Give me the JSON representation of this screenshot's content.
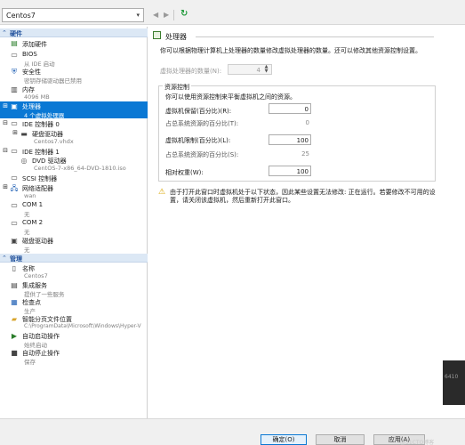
{
  "toolbar": {
    "vm_name": "Centos7",
    "back_icon": "back-arrow-icon",
    "forward_icon": "forward-arrow-icon",
    "refresh_icon": "refresh-icon"
  },
  "sidebar": {
    "hardware_header": "硬件",
    "management_header": "管理",
    "hardware_items": [
      {
        "label": "添加硬件",
        "sub": "",
        "icon": "add-hardware-icon"
      },
      {
        "label": "BIOS",
        "sub": "从 IDE 启动",
        "icon": "bios-icon"
      },
      {
        "label": "安全性",
        "sub": "密钥存储驱动器已禁用",
        "icon": "shield-icon"
      },
      {
        "label": "内存",
        "sub": "4096 MB",
        "icon": "memory-icon"
      },
      {
        "label": "处理器",
        "sub": "4 个虚拟处理器",
        "icon": "processor-icon"
      },
      {
        "label": "IDE 控制器 0",
        "sub": "",
        "icon": "ide-controller-icon"
      },
      {
        "label": "硬盘驱动器",
        "sub": "Centos7.vhdx",
        "icon": "hard-drive-icon"
      },
      {
        "label": "IDE 控制器 1",
        "sub": "",
        "icon": "ide-controller-icon"
      },
      {
        "label": "DVD 驱动器",
        "sub": "CentOS-7-x86_64-DVD-1810.iso",
        "icon": "dvd-icon"
      },
      {
        "label": "SCSI 控制器",
        "sub": "",
        "icon": "scsi-controller-icon"
      },
      {
        "label": "网络适配器",
        "sub": "wan",
        "icon": "network-adapter-icon"
      },
      {
        "label": "COM 1",
        "sub": "无",
        "icon": "com-port-icon"
      },
      {
        "label": "COM 2",
        "sub": "无",
        "icon": "com-port-icon"
      },
      {
        "label": "磁盘驱动器",
        "sub": "无",
        "icon": "floppy-icon"
      }
    ],
    "management_items": [
      {
        "label": "名称",
        "sub": "Centos7",
        "icon": "name-icon"
      },
      {
        "label": "集成服务",
        "sub": "提供了一些服务",
        "icon": "integration-services-icon"
      },
      {
        "label": "检查点",
        "sub": "生产",
        "icon": "checkpoint-icon"
      },
      {
        "label": "智能分页文件位置",
        "sub": "C:\\ProgramData\\Microsoft\\Windows\\Hyper-V",
        "icon": "folder-icon"
      },
      {
        "label": "自动启动操作",
        "sub": "始终启动",
        "icon": "auto-start-icon"
      },
      {
        "label": "自动停止操作",
        "sub": "保存",
        "icon": "auto-stop-icon"
      }
    ]
  },
  "processor": {
    "header": "处理器",
    "description": "你可以根据物理计算机上处理器的数量修改虚拟处理器的数量。还可以修改其他资源控制设置。",
    "vproc_label": "虚拟处理器的数量(N):",
    "vproc_value": "4",
    "resource_group_title": "资源控制",
    "resource_group_desc": "你可以使用资源控制来平衡虚拟机之间的资源。",
    "reserve_label": "虚拟机保留(百分比)(R):",
    "reserve_value": "0",
    "reserve_total_label": "占总系统资源的百分比(T):",
    "reserve_total_value": "0",
    "limit_label": "虚拟机限制(百分比)(L):",
    "limit_value": "100",
    "limit_total_label": "占总系统资源的百分比(S):",
    "limit_total_value": "25",
    "weight_label": "相对权重(W):",
    "weight_value": "100",
    "warning_text": "由于打开此窗口时虚拟机处于以下状态，因此某些设置无法修改: 正在运行。若要修改不可用的设置，请关闭该虚拟机，然后重新打开此窗口。"
  },
  "footer": {
    "ok_label": "确定(O)",
    "cancel_label": "取消",
    "apply_label": "应用(A)",
    "watermark": "@51CTO博客"
  },
  "corner_text": "6410"
}
